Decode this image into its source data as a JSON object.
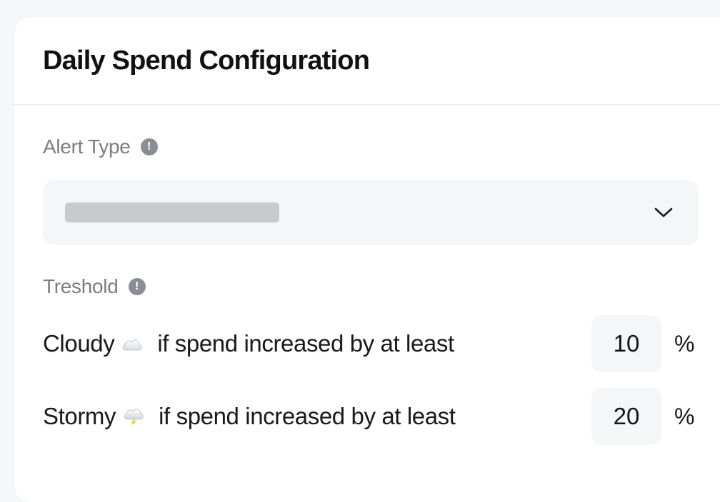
{
  "card": {
    "title": "Daily Spend Configuration"
  },
  "alert_type": {
    "label": "Alert Type",
    "info_icon": "info-circle-icon",
    "select": {
      "selected_value": "",
      "chevron_icon": "chevron-down-icon"
    }
  },
  "threshold": {
    "label": "Treshold",
    "info_icon": "info-circle-icon",
    "rules": [
      {
        "level": "Cloudy",
        "icon": "cloud-icon",
        "text": "if spend increased by at least",
        "value": "10",
        "unit": "%"
      },
      {
        "level": "Stormy",
        "icon": "storm-cloud-icon",
        "text": "if spend increased by at least",
        "value": "20",
        "unit": "%"
      }
    ]
  },
  "colors": {
    "background": "#f6f7f8",
    "card": "#ffffff",
    "field": "#f5f6f7",
    "label": "#7a7d83",
    "placeholder_bar": "#c9cacd"
  }
}
